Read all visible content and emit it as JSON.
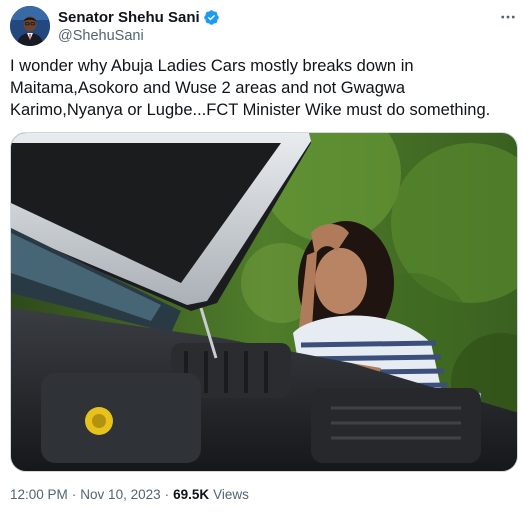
{
  "tweet": {
    "author_name": "Senator Shehu Sani",
    "handle": "@ShehuSani",
    "text": "I wonder why Abuja Ladies Cars mostly breaks down in Maitama,Asokoro and Wuse 2 areas and not Gwagwa Karimo,Nyanya or Lugbe...FCT Minister Wike must do something.",
    "time": "12:00 PM",
    "separator": "·",
    "date": "Nov 10, 2023",
    "views_count": "69.5K",
    "views_label": "Views"
  },
  "icons": {
    "verified": "verified-badge-icon",
    "more": "more-options-icon"
  },
  "colors": {
    "verified_blue": "#1d9bf0",
    "secondary_text": "#536471",
    "primary_text": "#0f1419"
  }
}
